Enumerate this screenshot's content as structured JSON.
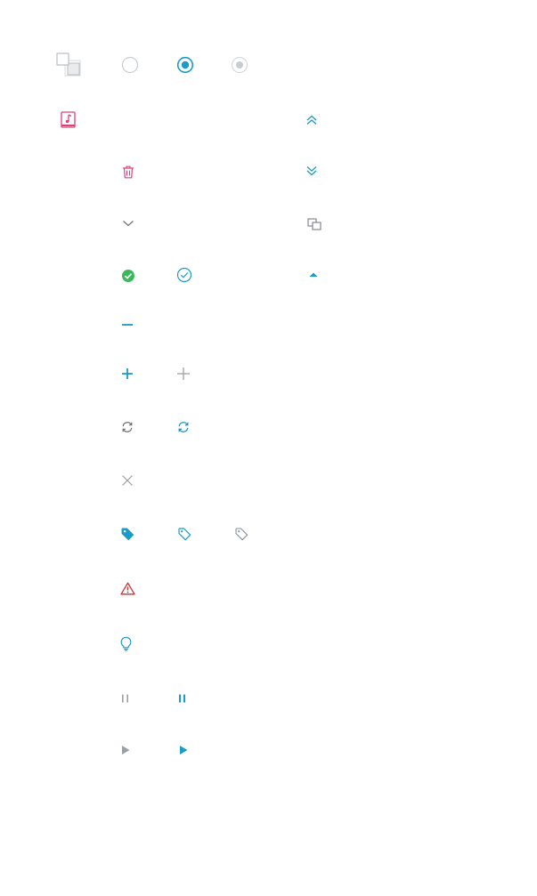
{
  "colors": {
    "accent": "#1a9bc8",
    "pink": "#e0407a",
    "gray": "#9aa0a6",
    "dark_gray": "#6b7075",
    "green": "#3cb85a",
    "red": "#d32f2f",
    "radio_border": "#c9ced3",
    "radio_disabled_fill": "#c8ccd0"
  },
  "icons": [
    "copy-pages-icon",
    "radio-unchecked",
    "radio-checked",
    "radio-checked-disabled",
    "music-file-icon",
    "chevrons-up-icon",
    "trash-icon",
    "chevrons-down-icon",
    "chevron-down-icon",
    "duplicate-icon",
    "check-circle-filled-icon",
    "check-circle-outline-icon",
    "caret-up-icon",
    "minus-icon",
    "plus-icon",
    "plus-light-icon",
    "refresh-icon",
    "refresh-accent-icon",
    "close-icon",
    "tag-filled-icon",
    "tag-outline-accent-icon",
    "tag-outline-gray-icon",
    "warning-icon",
    "lightbulb-icon",
    "pause-gray-icon",
    "pause-accent-icon",
    "play-gray-icon",
    "play-accent-icon"
  ]
}
